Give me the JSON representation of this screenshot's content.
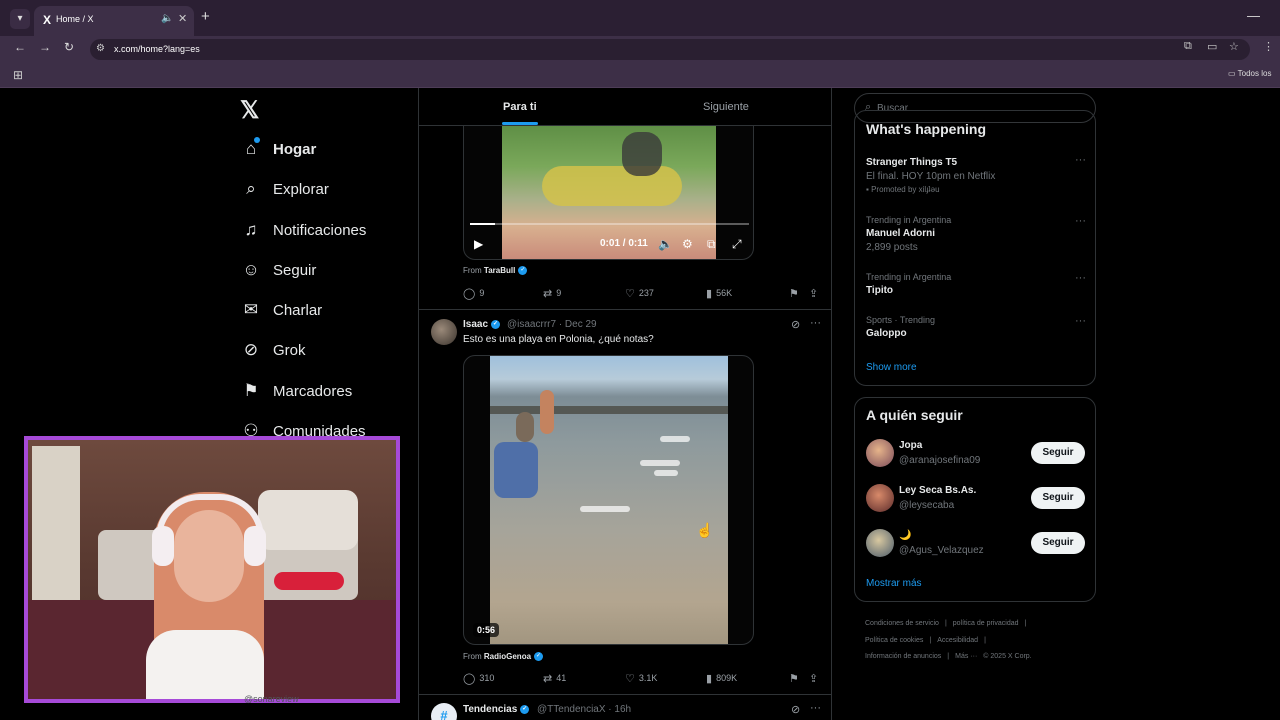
{
  "browser": {
    "tab_title": "Home / X",
    "url": "x.com/home?lang=es",
    "bookmark_folder": "Todos los"
  },
  "sidebar": {
    "items": [
      {
        "label": "Hogar",
        "icon": "home-icon"
      },
      {
        "label": "Explorar",
        "icon": "search-icon"
      },
      {
        "label": "Notificaciones",
        "icon": "bell-icon"
      },
      {
        "label": "Seguir",
        "icon": "add-person-icon"
      },
      {
        "label": "Charlar",
        "icon": "mail-icon"
      },
      {
        "label": "Grok",
        "icon": "grok-icon"
      },
      {
        "label": "Marcadores",
        "icon": "bookmark-icon"
      },
      {
        "label": "Comunidades",
        "icon": "people-icon"
      }
    ]
  },
  "timeline": {
    "tabs": [
      "Para ti",
      "Siguiente"
    ],
    "tweet1": {
      "video_time": "0:01 / 0:11",
      "progress": 0.09,
      "from_label": "From",
      "from_user": "TaraBull",
      "replies": "9",
      "retweets": "9",
      "likes": "237",
      "views": "56K"
    },
    "tweet2": {
      "name": "Isaac",
      "handle": "@isaacrrr7 · Dec 29",
      "text": "Esto es una playa en Polonia, ¿qué notas?",
      "duration": "0:56",
      "from_label": "From",
      "from_user": "RadioGenoa",
      "replies": "310",
      "retweets": "41",
      "likes": "3.1K",
      "views": "809K"
    },
    "tweet3": {
      "name": "Tendencias",
      "handle": "@TTendenciaX · 16h"
    }
  },
  "right": {
    "search_placeholder": "Buscar",
    "happening_title": "What's happening",
    "trends": [
      {
        "context": "",
        "name": "Stranger Things T5",
        "sub": "El final. HOY 10pm en Netflix",
        "promo": "Promoted by xilɟʇəu"
      },
      {
        "context": "Trending in Argentina",
        "name": "Manuel Adorni",
        "sub": "2,899 posts",
        "promo": ""
      },
      {
        "context": "Trending in Argentina",
        "name": "Tipito",
        "sub": "",
        "promo": ""
      },
      {
        "context": "Sports · Trending",
        "name": "Galoppo",
        "sub": "",
        "promo": ""
      }
    ],
    "show_more": "Show more",
    "follow_title": "A quién seguir",
    "follow": [
      {
        "name": "Jopa",
        "handle": "@aranajosefina09",
        "button": "Seguir"
      },
      {
        "name": "Ley Seca Bs.As.",
        "handle": "@leysecaba",
        "button": "Seguir"
      },
      {
        "name": "🌙",
        "handle": "@Agus_Velazquez",
        "button": "Seguir"
      }
    ],
    "mostrar_mas": "Mostrar más",
    "footer": [
      "Condiciones de servicio",
      "|",
      "política de privacidad",
      "|",
      "Política de cookies",
      "|",
      "Accesibilidad",
      "|",
      "Información de anuncios",
      "|",
      "Más ···",
      "© 2025 X Corp."
    ]
  },
  "overlay": {
    "below_text": "@sonareview"
  },
  "colors": {
    "accent": "#1d9bf0",
    "webcam_border": "#a64ad8",
    "browser_chrome": "#3d2f47"
  }
}
